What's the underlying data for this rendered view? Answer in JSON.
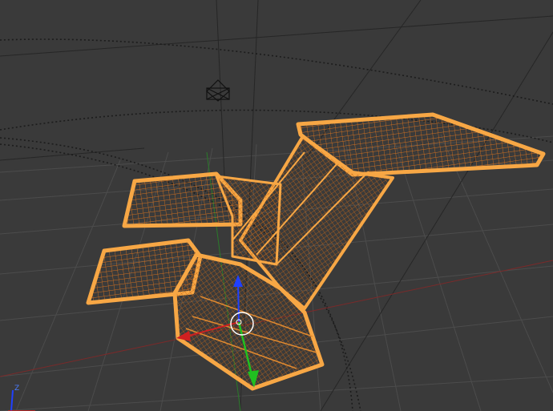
{
  "viewport": {
    "colors": {
      "background": "#3a3a3a",
      "grid": "#505050",
      "grid_dark": "#2c2c2c",
      "selection": "#f7a745",
      "wire": "#e0822e",
      "x_axis": "#d02020",
      "y_axis": "#20c020",
      "z_axis": "#2040ff",
      "horizon_line": "#8a2c2c"
    },
    "icons": {
      "camera": "camera-icon",
      "manipulator": "transform-gizmo-icon",
      "axis_indicator": "view-axis-icon"
    },
    "axis_indicator_label": "Z"
  }
}
